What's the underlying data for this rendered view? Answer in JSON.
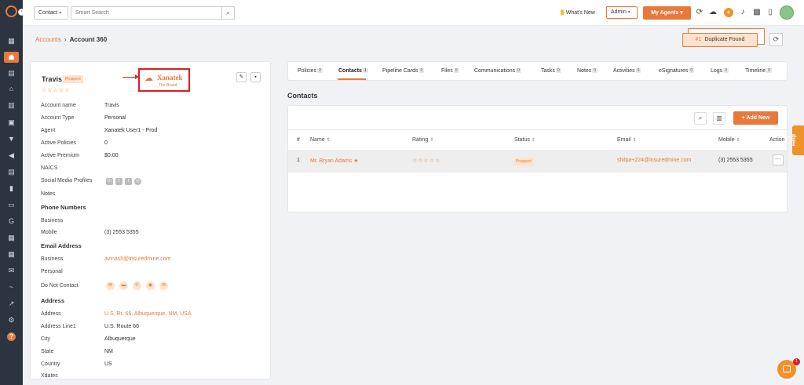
{
  "topbar": {
    "contact_select": "Contact",
    "search_placeholder": "Smart Search",
    "whats_new": "What's New",
    "admin_select": "Admin",
    "my_agents": "My Agents"
  },
  "breadcrumb": {
    "parent": "Accounts",
    "current": "Account 360"
  },
  "duplicate": {
    "number": "#1",
    "label": "Duplicate Found"
  },
  "account": {
    "name": "Travis",
    "badge": "Prospect",
    "stars": "☆☆☆☆☆",
    "logo_title": "Xanatek",
    "logo_sub": "The Brand",
    "fields": [
      {
        "label": "Account name",
        "value": "Travis"
      },
      {
        "label": "Account Type",
        "value": "Personal"
      },
      {
        "label": "Agent",
        "value": "Xanatek User1 - Prod"
      },
      {
        "label": "Active Policies",
        "value": "0"
      },
      {
        "label": "Active Premium",
        "value": "$0.00"
      },
      {
        "label": "NAICS",
        "value": ""
      },
      {
        "label": "Social Media Profiles",
        "value": ""
      },
      {
        "label": "Notes",
        "value": ""
      }
    ],
    "phone_section": "Phone Numbers",
    "phone": [
      {
        "label": "Business",
        "value": ""
      },
      {
        "label": "Mobile",
        "value": "(3) 2553 5355"
      }
    ],
    "email_section": "Email Address",
    "email": [
      {
        "label": "Business",
        "value": "avinash@insuredmine.com"
      },
      {
        "label": "Personal",
        "value": ""
      }
    ],
    "dnc_label": "Do Not Contact",
    "address_section": "Address",
    "address": [
      {
        "label": "Address",
        "value": "U.S. Rt. 66, Albuquerque, NM, USA"
      },
      {
        "label": "Address Line1",
        "value": "U.S. Route 66"
      },
      {
        "label": "City",
        "value": "Albuquerque"
      },
      {
        "label": "State",
        "value": "NM"
      },
      {
        "label": "Country",
        "value": "US"
      },
      {
        "label": "Xdates",
        "value": ""
      }
    ]
  },
  "tabs": [
    {
      "label": "Policies",
      "count": "0"
    },
    {
      "label": "Contacts",
      "count": "1"
    },
    {
      "label": "Pipeline Cards",
      "count": "0"
    },
    {
      "label": "Files",
      "count": "0"
    },
    {
      "label": "Communications",
      "count": "0"
    },
    {
      "label": "Tasks",
      "count": "0"
    },
    {
      "label": "Notes",
      "count": "0"
    },
    {
      "label": "Activities",
      "count": "0"
    },
    {
      "label": "eSignatures",
      "count": "0"
    },
    {
      "label": "Logs",
      "count": "0"
    },
    {
      "label": "Timeline",
      "count": "0"
    }
  ],
  "contacts": {
    "title": "Contacts",
    "add_new": "+ Add New",
    "headers": [
      "#",
      "Name",
      "Rating",
      "Status",
      "Email",
      "Mobile",
      "Action"
    ],
    "rows": [
      {
        "num": "1",
        "name": "Mr. Bryan Adams",
        "rating": "☆☆☆☆☆",
        "status": "Prospect",
        "email": "shilpa+224@insuredmine.com",
        "mobile": "(3) 2553 5355"
      }
    ]
  },
  "help": "Help",
  "chat_badge": "1",
  "colors": {
    "accent": "#e8793a",
    "sidebar": "#2b3440",
    "highlight_border": "#d91e1e"
  }
}
